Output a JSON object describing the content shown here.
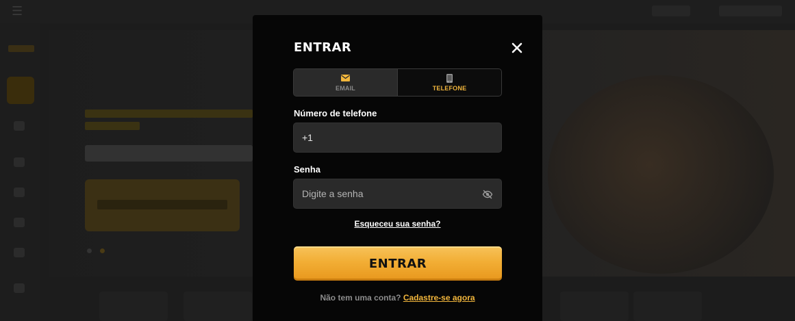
{
  "modal": {
    "title": "ENTRAR",
    "tabs": [
      {
        "label": "EMAIL",
        "icon": "envelope-icon",
        "active": false
      },
      {
        "label": "TELEFONE",
        "icon": "phone-icon",
        "active": true
      }
    ],
    "phone": {
      "label": "Número de telefone",
      "value": "+1"
    },
    "password": {
      "label": "Senha",
      "placeholder": "Digite a senha"
    },
    "forgot_label": "Esqueceu sua senha?",
    "submit_label": "ENTRAR",
    "signup": {
      "prompt": "Não tem uma conta?",
      "link": "Cadastre-se agora"
    }
  },
  "colors": {
    "accent": "#f2b63c",
    "modal_bg": "#060606",
    "input_bg": "#2a2a2a",
    "button_gradient_top": "#f7c25a",
    "button_gradient_bottom": "#e8971c"
  }
}
